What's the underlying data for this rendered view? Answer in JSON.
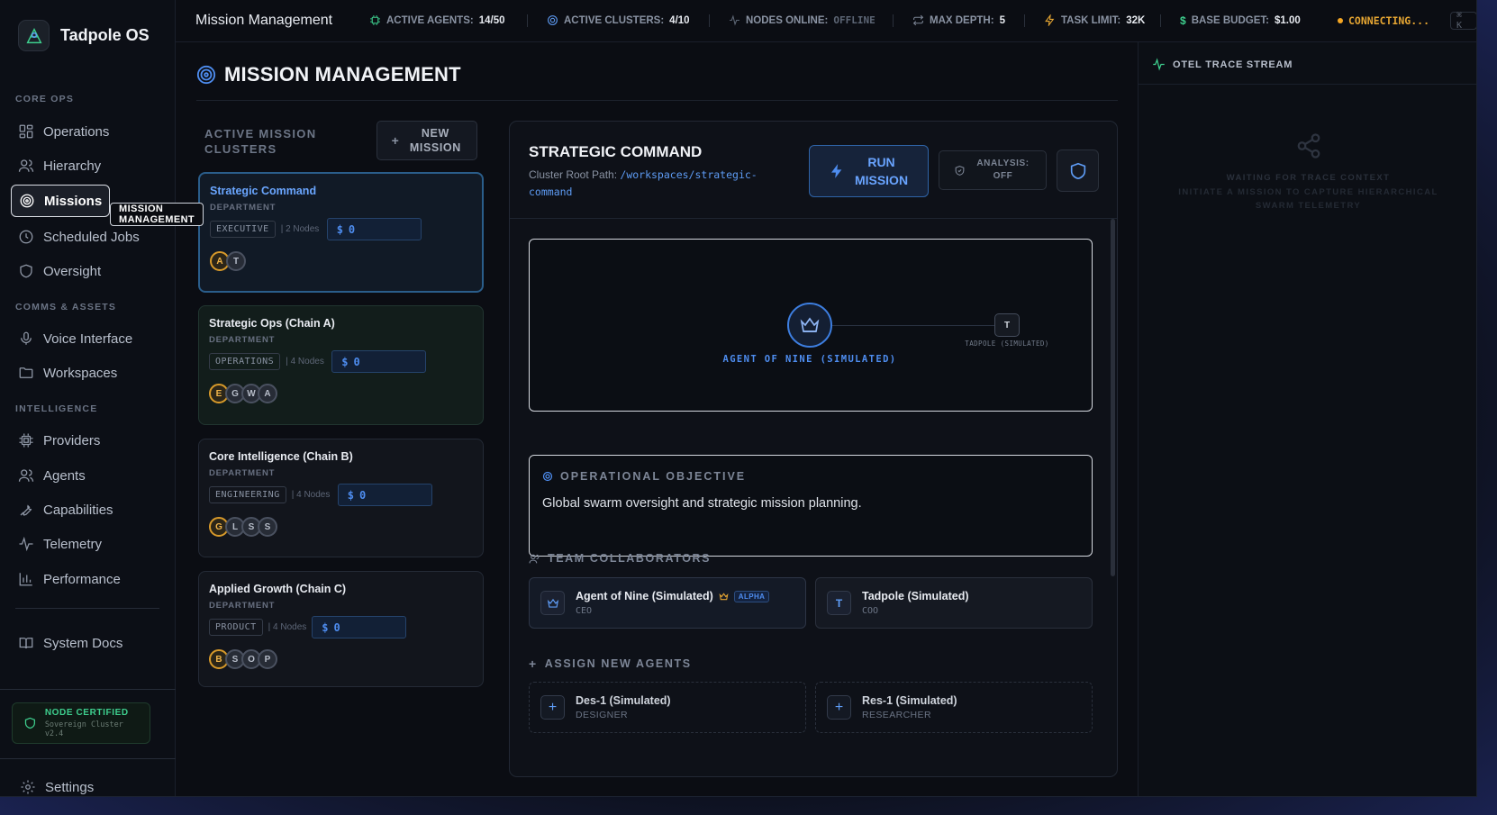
{
  "app": {
    "name": "Tadpole OS"
  },
  "sidebar": {
    "sections": [
      {
        "title": "CORE OPS"
      },
      {
        "title": "COMMS & ASSETS"
      },
      {
        "title": "INTELLIGENCE"
      }
    ],
    "items": [
      {
        "label": "Operations",
        "icon": "grid-icon"
      },
      {
        "label": "Hierarchy",
        "icon": "users-icon"
      },
      {
        "label": "Missions",
        "icon": "target-icon",
        "active": true
      },
      {
        "label": "Scheduled Jobs",
        "icon": "clock-icon"
      },
      {
        "label": "Oversight",
        "icon": "shield-icon"
      },
      {
        "label": "Voice Interface",
        "icon": "mic-icon"
      },
      {
        "label": "Workspaces",
        "icon": "folder-icon"
      },
      {
        "label": "Providers",
        "icon": "chip-icon"
      },
      {
        "label": "Agents",
        "icon": "users-icon"
      },
      {
        "label": "Capabilities",
        "icon": "wrench-icon"
      },
      {
        "label": "Telemetry",
        "icon": "pulse-icon"
      },
      {
        "label": "Performance",
        "icon": "bar-chart-icon"
      },
      {
        "label": "System Docs",
        "icon": "book-icon"
      }
    ],
    "tooltip": "MISSION MANAGEMENT",
    "certificate": {
      "title": "NODE CERTIFIED",
      "subtitle": "Sovereign Cluster v2.4"
    },
    "settings_label": "Settings"
  },
  "topbar": {
    "title": "Mission Management",
    "stats": [
      {
        "label": "ACTIVE AGENTS:",
        "value": "14/50"
      },
      {
        "label": "ACTIVE CLUSTERS:",
        "value": "4/10"
      },
      {
        "label": "NODES ONLINE:",
        "value": "OFFLINE"
      },
      {
        "label": "MAX DEPTH:",
        "value": "5"
      },
      {
        "label": "TASK LIMIT:",
        "value": "32K"
      },
      {
        "label": "BASE BUDGET:",
        "value": "$1.00"
      }
    ],
    "status": "CONNECTING...",
    "shortcut": "⌘ K"
  },
  "page": {
    "title": "MISSION MANAGEMENT",
    "clusters_label": "ACTIVE MISSION CLUSTERS",
    "new_mission_label": "NEW MISSION"
  },
  "clusters": [
    {
      "name": "Strategic Command",
      "dept": "DEPARTMENT",
      "tag": "EXECUTIVE",
      "nodes": "| 2 Nodes",
      "budget": "0",
      "avatars": [
        "A",
        "T"
      ]
    },
    {
      "name": "Strategic Ops (Chain A)",
      "dept": "DEPARTMENT",
      "tag": "OPERATIONS",
      "nodes": "| 4 Nodes",
      "budget": "0",
      "avatars": [
        "E",
        "G",
        "W",
        "A"
      ]
    },
    {
      "name": "Core Intelligence (Chain B)",
      "dept": "DEPARTMENT",
      "tag": "ENGINEERING",
      "nodes": "| 4 Nodes",
      "budget": "0",
      "avatars": [
        "G",
        "L",
        "S",
        "S"
      ]
    },
    {
      "name": "Applied Growth (Chain C)",
      "dept": "DEPARTMENT",
      "tag": "PRODUCT",
      "nodes": "| 4 Nodes",
      "budget": "0",
      "avatars": [
        "B",
        "S",
        "O",
        "P"
      ]
    }
  ],
  "currency_symbol": "$",
  "mission": {
    "title": "STRATEGIC COMMAND",
    "path_label": "Cluster Root Path:",
    "path": "/workspaces/strategic-command",
    "run_label": "RUN MISSION",
    "analysis_label": "ANALYSIS: OFF",
    "graph": {
      "root_label": "AGENT OF NINE (SIMULATED)",
      "child_initial": "T",
      "child_label": "TADPOLE (SIMULATED)"
    },
    "objective_title": "OPERATIONAL OBJECTIVE",
    "objective_text": "Global swarm oversight and strategic mission planning.",
    "team_title": "TEAM COLLABORATORS",
    "team": [
      {
        "name": "Agent of Nine (Simulated)",
        "role": "CEO",
        "badge": "ALPHA"
      },
      {
        "name": "Tadpole (Simulated)",
        "role": "COO",
        "initial": "T"
      }
    ],
    "assign_title": "ASSIGN NEW AGENTS",
    "assign": [
      {
        "name": "Des-1 (Simulated)",
        "role": "DESIGNER"
      },
      {
        "name": "Res-1 (Simulated)",
        "role": "RESEARCHER"
      }
    ]
  },
  "trace": {
    "title": "OTEL TRACE STREAM",
    "empty_line1": "WAITING FOR TRACE CONTEXT",
    "empty_line2": "INITIATE A MISSION TO CAPTURE HIERARCHICAL SWARM TELEMETRY"
  },
  "colors": {
    "accent": "#4e8df0",
    "lead_avatar": "#d89a2a",
    "certified": "#3ecf8e",
    "connecting": "#f5a623"
  }
}
